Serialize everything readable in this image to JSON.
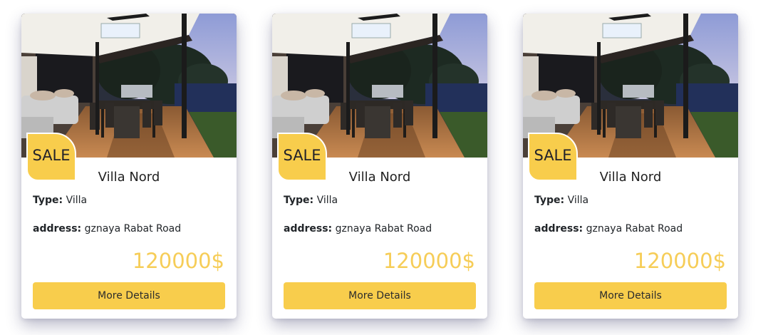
{
  "colors": {
    "accent": "#f8cd4c",
    "price": "#f6cd58",
    "text": "#212529"
  },
  "listings": [
    {
      "badge": "SALE",
      "title": "Villa Nord",
      "type_label": "Type:",
      "type_value": "Villa",
      "address_label": "address:",
      "address_value": "gznaya Rabat Road",
      "price": "120000$",
      "button_label": "More Details",
      "image_icon": "villa-patio-photo"
    },
    {
      "badge": "SALE",
      "title": "Villa Nord",
      "type_label": "Type:",
      "type_value": "Villa",
      "address_label": "address:",
      "address_value": "gznaya Rabat Road",
      "price": "120000$",
      "button_label": "More Details",
      "image_icon": "villa-patio-photo"
    },
    {
      "badge": "SALE",
      "title": "Villa Nord",
      "type_label": "Type:",
      "type_value": "Villa",
      "address_label": "address:",
      "address_value": "gznaya Rabat Road",
      "price": "120000$",
      "button_label": "More Details",
      "image_icon": "villa-patio-photo"
    }
  ]
}
